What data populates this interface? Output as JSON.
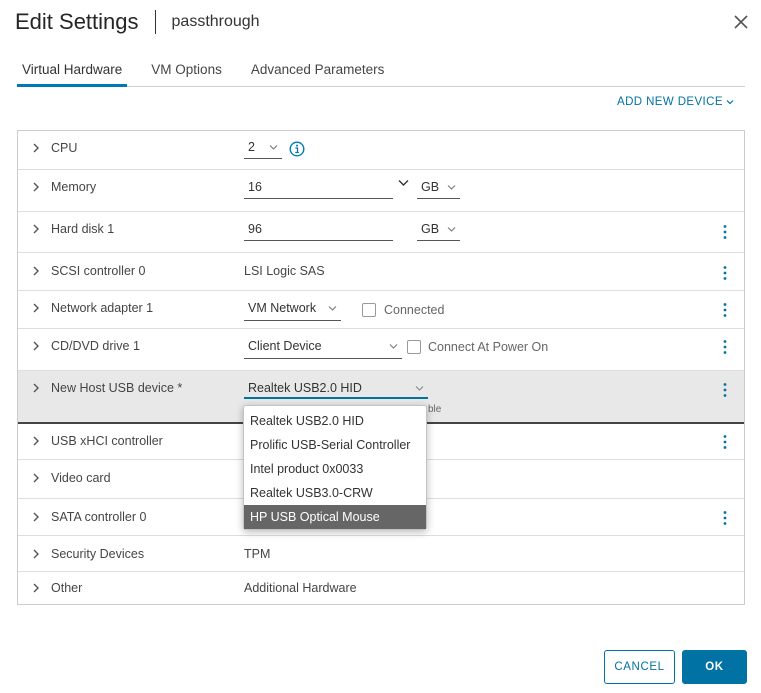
{
  "header": {
    "title": "Edit Settings",
    "vm_name": "passthrough"
  },
  "tabs": [
    {
      "label": "Virtual Hardware",
      "active": true
    },
    {
      "label": "VM Options"
    },
    {
      "label": "Advanced Parameters"
    }
  ],
  "add_device": "ADD NEW DEVICE",
  "rows": {
    "cpu": {
      "label": "CPU",
      "value": "2"
    },
    "memory": {
      "label": "Memory",
      "value": "16",
      "unit": "GB"
    },
    "hard_disk": {
      "label": "Hard disk 1",
      "value": "96",
      "unit": "GB"
    },
    "scsi": {
      "label": "SCSI controller 0",
      "value": "LSI Logic SAS"
    },
    "network": {
      "label": "Network adapter 1",
      "value": "VM Network",
      "connected_label": "Connected"
    },
    "cdrom": {
      "label": "CD/DVD drive 1",
      "value": "Client Device",
      "connect_label": "Connect At Power On"
    },
    "usb_new": {
      "label": "New Host USB device *",
      "value": "Realtek USB2.0 HID",
      "hint_tail": "ble"
    },
    "usb_xhci": {
      "label": "USB xHCI controller"
    },
    "video": {
      "label": "Video card"
    },
    "sata": {
      "label": "SATA controller 0"
    },
    "security": {
      "label": "Security Devices",
      "value": "TPM"
    },
    "other": {
      "label": "Other",
      "value": "Additional Hardware"
    }
  },
  "usb_options": [
    "Realtek USB2.0 HID",
    "Prolific USB-Serial Controller",
    "Intel product 0x0033",
    "Realtek USB3.0-CRW",
    "HP USB Optical Mouse"
  ],
  "footer": {
    "cancel": "CANCEL",
    "ok": "OK"
  },
  "colors": {
    "accent": "#0072a3",
    "tab_underline": "#0079b8",
    "info_icon": "#0079b8"
  }
}
